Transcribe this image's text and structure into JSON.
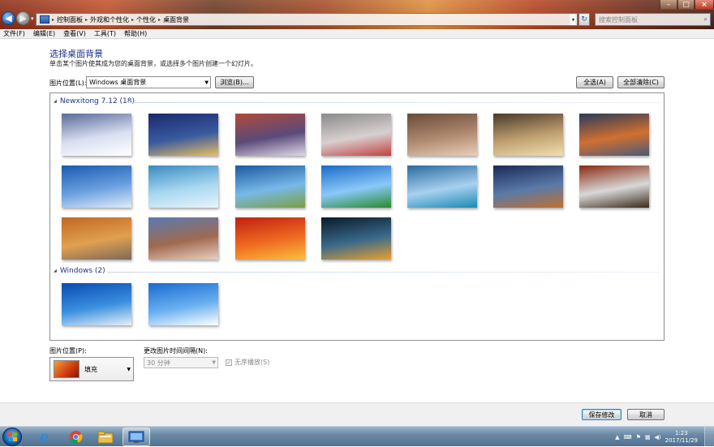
{
  "window": {
    "breadcrumb": [
      "控制面板",
      "外观和个性化",
      "个性化",
      "桌面背景"
    ],
    "search_placeholder": "搜索控制面板",
    "controls": {
      "minimize": "–",
      "maximize": "□",
      "close": "×"
    }
  },
  "menu": [
    "文件(F)",
    "编辑(E)",
    "查看(V)",
    "工具(T)",
    "帮助(H)"
  ],
  "page": {
    "title": "选择桌面背景",
    "subtitle": "单击某个图片使其成为您的桌面背景，或选择多个图片创建一个幻灯片。",
    "location_label": "图片位置(L):",
    "location_value": "Windows 桌面背景",
    "browse_label": "浏览(B)...",
    "select_all_label": "全选(A)",
    "clear_all_label": "全部清除(C)"
  },
  "groups": [
    {
      "title": "Newxitong 7.12 (18)",
      "thumbnails": [
        {
          "name": "snow-cottage",
          "colors": [
            "#5a6a9a",
            "#d8dff0",
            "#ffffff"
          ]
        },
        {
          "name": "christmas-village",
          "colors": [
            "#1a2a6a",
            "#3a5aa0",
            "#e8c060"
          ]
        },
        {
          "name": "sunset-snowfield",
          "colors": [
            "#b04a3a",
            "#5a4a7a",
            "#e0d8e8"
          ]
        },
        {
          "name": "frosted-berries",
          "colors": [
            "#8a8a8a",
            "#d8d0d0",
            "#c04040"
          ]
        },
        {
          "name": "girl-portrait-1",
          "colors": [
            "#6a4a3a",
            "#b08a70",
            "#e8d0b8"
          ]
        },
        {
          "name": "girl-portrait-2",
          "colors": [
            "#4a3a2a",
            "#c0a070",
            "#f0e0b0"
          ]
        },
        {
          "name": "lake-sunset",
          "colors": [
            "#2a3a5a",
            "#d07030",
            "#4a5a7a"
          ]
        },
        {
          "name": "blue-snow-mountain",
          "colors": [
            "#1a5ab0",
            "#6aa0e0",
            "#e0ecf8"
          ]
        },
        {
          "name": "ice-texture",
          "colors": [
            "#3a8ac0",
            "#a8d8f0",
            "#e8f4fc"
          ]
        },
        {
          "name": "wind-turbine",
          "colors": [
            "#1a5aa0",
            "#78b8e8",
            "#7aa040"
          ]
        },
        {
          "name": "green-field-sky",
          "colors": [
            "#1a6ac8",
            "#8ac8f8",
            "#2a8a30"
          ]
        },
        {
          "name": "mountain-lake-blue",
          "colors": [
            "#2a6aa0",
            "#a8d0f0",
            "#1a8ab0"
          ]
        },
        {
          "name": "hallstatt-town",
          "colors": [
            "#1a2a5a",
            "#5a7aa8",
            "#c07030"
          ]
        },
        {
          "name": "autumn-waterfall",
          "colors": [
            "#8a2a10",
            "#d8d8d8",
            "#3a2a1a"
          ]
        },
        {
          "name": "autumn-house",
          "colors": [
            "#c06820",
            "#e0a050",
            "#7a6a5a"
          ]
        },
        {
          "name": "high-sierra",
          "colors": [
            "#5a7ab0",
            "#a06a50",
            "#e8d0c0"
          ]
        },
        {
          "name": "red-flower-macro",
          "colors": [
            "#c02010",
            "#f06a20",
            "#f8c040"
          ]
        },
        {
          "name": "city-night-lights",
          "colors": [
            "#0a1a2a",
            "#3a6a8a",
            "#e8a030"
          ]
        }
      ]
    },
    {
      "title": "Windows (2)",
      "thumbnails": [
        {
          "name": "windows7-default",
          "colors": [
            "#0a4ab0",
            "#3a90e0",
            "#e8f0f8"
          ]
        },
        {
          "name": "daisies-blue",
          "colors": [
            "#1a6ad0",
            "#68b0f0",
            "#ffffff"
          ]
        }
      ]
    }
  ],
  "bottom": {
    "position_label": "图片位置(P):",
    "position_value": "填充",
    "interval_label": "更改图片时间间隔(N):",
    "interval_value": "30 分钟",
    "shuffle_label": "无序播放(S)",
    "shuffle_checked": true
  },
  "footer": {
    "save_label": "保存修改",
    "cancel_label": "取消"
  },
  "taskbar": {
    "pinned": [
      "internet-explorer-icon",
      "chrome-icon",
      "explorer-folder-icon",
      "control-panel-icon"
    ],
    "time": "1:23",
    "date": "2017/11/29"
  }
}
